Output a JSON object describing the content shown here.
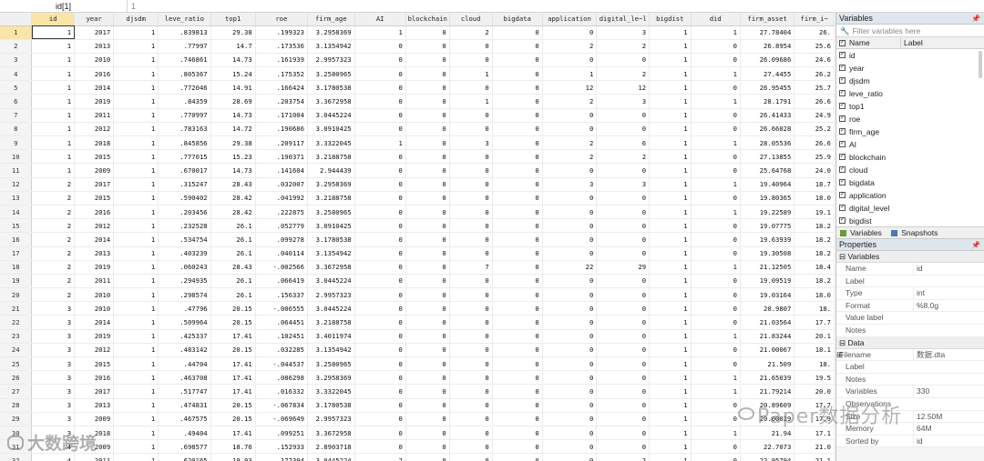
{
  "editbar": {
    "cell_ref": "id[1]",
    "cell_value": "1"
  },
  "columns": [
    "id",
    "year",
    "djsdm",
    "leve_ratio",
    "top1",
    "roe",
    "firm_age",
    "AI",
    "blockchain",
    "cloud",
    "bigdata",
    "application",
    "digital_le~l",
    "bigdist",
    "did",
    "firm_asset",
    "firm_i~"
  ],
  "rows": [
    [
      "1",
      "2017",
      "1",
      ".839813",
      "29.38",
      ".199323",
      "3.2958369",
      "1",
      "0",
      "2",
      "0",
      "0",
      "3",
      "1",
      "1",
      "27.78404",
      "26."
    ],
    [
      "1",
      "2013",
      "1",
      ".77997",
      "14.7",
      ".173536",
      "3.1354942",
      "0",
      "0",
      "0",
      "0",
      "2",
      "2",
      "1",
      "0",
      "26.8954",
      "25.6"
    ],
    [
      "1",
      "2010",
      "1",
      ".746861",
      "14.73",
      ".161939",
      "2.9957323",
      "0",
      "0",
      "0",
      "0",
      "0",
      "0",
      "1",
      "0",
      "26.09686",
      "24.6"
    ],
    [
      "1",
      "2016",
      "1",
      ".805367",
      "15.24",
      ".175352",
      "3.2580965",
      "0",
      "0",
      "1",
      "0",
      "1",
      "2",
      "1",
      "1",
      "27.4455",
      "26.2"
    ],
    [
      "1",
      "2014",
      "1",
      ".772046",
      "14.91",
      ".166424",
      "3.1780538",
      "0",
      "0",
      "0",
      "0",
      "12",
      "12",
      "1",
      "0",
      "26.95455",
      "25.7"
    ],
    [
      "1",
      "2019",
      "1",
      ".84359",
      "28.69",
      ".203754",
      "3.3672958",
      "0",
      "0",
      "1",
      "0",
      "2",
      "3",
      "1",
      "1",
      "28.1791",
      "26.6"
    ],
    [
      "1",
      "2011",
      "1",
      ".770997",
      "14.73",
      ".171004",
      "3.0445224",
      "0",
      "0",
      "0",
      "0",
      "0",
      "0",
      "1",
      "0",
      "26.41433",
      "24.9"
    ],
    [
      "1",
      "2012",
      "1",
      ".783163",
      "14.72",
      ".190686",
      "3.0910425",
      "0",
      "0",
      "0",
      "0",
      "0",
      "0",
      "1",
      "0",
      "26.66028",
      "25.2"
    ],
    [
      "1",
      "2018",
      "1",
      ".845856",
      "29.38",
      ".209117",
      "3.3322045",
      "1",
      "0",
      "3",
      "0",
      "2",
      "6",
      "1",
      "1",
      "28.05536",
      "26.6"
    ],
    [
      "1",
      "2015",
      "1",
      ".777015",
      "15.23",
      ".190371",
      "3.2188758",
      "0",
      "0",
      "0",
      "0",
      "2",
      "2",
      "1",
      "0",
      "27.13855",
      "25.9"
    ],
    [
      "1",
      "2009",
      "1",
      ".670017",
      "14.73",
      ".141604",
      "2.944439",
      "0",
      "0",
      "0",
      "0",
      "0",
      "0",
      "1",
      "0",
      "25.64768",
      "24.0"
    ],
    [
      "2",
      "2017",
      "1",
      ".315247",
      "28.43",
      ".032007",
      "3.2958369",
      "0",
      "0",
      "0",
      "0",
      "3",
      "3",
      "1",
      "1",
      "19.40964",
      "18.7"
    ],
    [
      "2",
      "2015",
      "1",
      ".590402",
      "28.42",
      ".041992",
      "3.2188758",
      "0",
      "0",
      "0",
      "0",
      "0",
      "0",
      "1",
      "0",
      "19.80365",
      "18.0"
    ],
    [
      "2",
      "2016",
      "1",
      ".203456",
      "28.42",
      ".222875",
      "3.2580965",
      "0",
      "0",
      "0",
      "0",
      "0",
      "0",
      "1",
      "1",
      "19.22589",
      "19.1"
    ],
    [
      "2",
      "2012",
      "1",
      ".232528",
      "26.1",
      ".052779",
      "3.0910425",
      "0",
      "0",
      "0",
      "0",
      "0",
      "0",
      "1",
      "0",
      "19.07775",
      "18.2"
    ],
    [
      "2",
      "2014",
      "1",
      ".534754",
      "26.1",
      ".099278",
      "3.1780538",
      "0",
      "0",
      "0",
      "0",
      "0",
      "0",
      "1",
      "0",
      "19.63939",
      "18.2"
    ],
    [
      "2",
      "2013",
      "1",
      ".403239",
      "26.1",
      ".040114",
      "3.1354942",
      "0",
      "0",
      "0",
      "0",
      "0",
      "0",
      "1",
      "0",
      "19.30508",
      "18.2"
    ],
    [
      "2",
      "2019",
      "1",
      ".060243",
      "28.43",
      "-.002566",
      "3.3672958",
      "0",
      "0",
      "7",
      "0",
      "22",
      "29",
      "1",
      "1",
      "21.12505",
      "18.4"
    ],
    [
      "2",
      "2011",
      "1",
      ".294935",
      "26.1",
      ".066419",
      "3.0445224",
      "0",
      "0",
      "0",
      "0",
      "0",
      "0",
      "1",
      "0",
      "19.09519",
      "18.2"
    ],
    [
      "2",
      "2010",
      "1",
      ".298574",
      "26.1",
      ".156337",
      "2.9957323",
      "0",
      "0",
      "0",
      "0",
      "0",
      "0",
      "1",
      "0",
      "19.03164",
      "18.0"
    ],
    [
      "3",
      "2010",
      "1",
      ".47796",
      "20.15",
      "-.006555",
      "3.0445224",
      "0",
      "0",
      "0",
      "0",
      "0",
      "0",
      "1",
      "0",
      "20.9807",
      "18."
    ],
    [
      "3",
      "2014",
      "1",
      ".509964",
      "20.15",
      ".064451",
      "3.2188758",
      "0",
      "0",
      "0",
      "0",
      "0",
      "0",
      "1",
      "0",
      "21.03564",
      "17.7"
    ],
    [
      "3",
      "2019",
      "1",
      ".425337",
      "17.41",
      ".102451",
      "3.4011974",
      "0",
      "0",
      "0",
      "0",
      "0",
      "0",
      "1",
      "1",
      "21.83244",
      "20.1"
    ],
    [
      "3",
      "2012",
      "1",
      ".483142",
      "20.15",
      ".032285",
      "3.1354942",
      "0",
      "0",
      "0",
      "0",
      "0",
      "0",
      "1",
      "0",
      "21.00067",
      "18.1"
    ],
    [
      "3",
      "2015",
      "1",
      ".44704",
      "17.41",
      "-.044537",
      "3.2580965",
      "0",
      "0",
      "0",
      "0",
      "0",
      "0",
      "1",
      "0",
      "21.509",
      "18."
    ],
    [
      "3",
      "2016",
      "1",
      ".463708",
      "17.41",
      ".086298",
      "3.2958369",
      "0",
      "0",
      "0",
      "0",
      "0",
      "0",
      "1",
      "1",
      "21.65039",
      "19.5"
    ],
    [
      "3",
      "2017",
      "1",
      ".517747",
      "17.41",
      ".016332",
      "3.3322045",
      "0",
      "0",
      "0",
      "0",
      "0",
      "0",
      "1",
      "1",
      "21.79214",
      "20.0"
    ],
    [
      "3",
      "2013",
      "1",
      ".474831",
      "20.15",
      "-.067834",
      "3.1780538",
      "0",
      "0",
      "0",
      "0",
      "0",
      "0",
      "1",
      "0",
      "20.89609",
      "17.7"
    ],
    [
      "3",
      "2009",
      "1",
      ".467575",
      "20.15",
      "-.069649",
      "2.9957323",
      "0",
      "0",
      "0",
      "0",
      "0",
      "0",
      "1",
      "0",
      "20.00029",
      "17.9"
    ],
    [
      "3",
      "2018",
      "1",
      ".49404",
      "17.41",
      ".099251",
      "3.3672958",
      "0",
      "0",
      "0",
      "0",
      "0",
      "0",
      "1",
      "1",
      "21.94",
      "17.1"
    ],
    [
      "4",
      "2009",
      "1",
      ".698577",
      "18.76",
      ".152933",
      "2.8903718",
      "0",
      "0",
      "0",
      "0",
      "0",
      "0",
      "1",
      "0",
      "22.7073",
      "21.0"
    ],
    [
      "4",
      "2011",
      "1",
      ".620165",
      "19.93",
      ".177394",
      "3.0445224",
      "2",
      "0",
      "0",
      "0",
      "0",
      "2",
      "1",
      "0",
      "22.95794",
      "21.1"
    ]
  ],
  "variables_panel": {
    "title": "Variables",
    "filter_placeholder": "Filter variables here",
    "col_name": "Name",
    "col_label": "Label",
    "items": [
      "id",
      "year",
      "djsdm",
      "leve_ratio",
      "top1",
      "roe",
      "firm_age",
      "AI",
      "blockchain",
      "cloud",
      "bigdata",
      "application",
      "digital_level",
      "bigdist"
    ],
    "tab_variables": "Variables",
    "tab_snapshots": "Snapshots"
  },
  "properties_panel": {
    "title": "Properties",
    "variables_section": "Variables",
    "var_props": [
      {
        "k": "Name",
        "v": "id"
      },
      {
        "k": "Label",
        "v": ""
      },
      {
        "k": "Type",
        "v": "int"
      },
      {
        "k": "Format",
        "v": "%8.0g"
      },
      {
        "k": "Value label",
        "v": ""
      },
      {
        "k": "Notes",
        "v": ""
      }
    ],
    "data_section": "Data",
    "data_props": [
      {
        "k": "Filename",
        "v": "数据.dta"
      },
      {
        "k": "Label",
        "v": ""
      },
      {
        "k": "Notes",
        "v": ""
      },
      {
        "k": "Variables",
        "v": "330"
      },
      {
        "k": "Observations",
        "v": ""
      },
      {
        "k": "Size",
        "v": "12.50M"
      },
      {
        "k": "Memory",
        "v": "64M"
      },
      {
        "k": "Sorted by",
        "v": "id"
      }
    ]
  },
  "watermarks": {
    "right": "Paper数据分析",
    "left": "大数跨境"
  },
  "colors": {
    "selected_header": "#fbe4a8",
    "panel_title": "#dfe6ee"
  }
}
